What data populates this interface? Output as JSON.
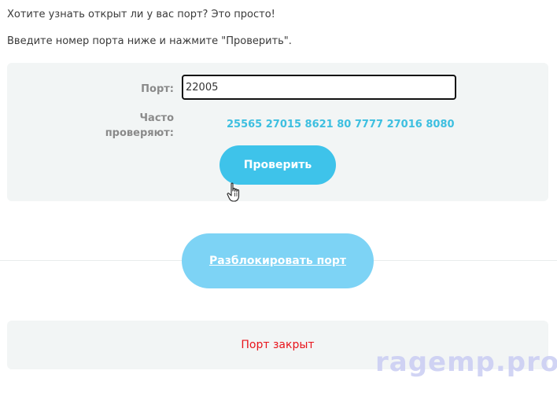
{
  "intro": {
    "line1": "Хотите узнать открыт ли у вас порт? Это просто!",
    "line2": "Введите номер порта ниже и нажмите \"Проверить\"."
  },
  "check_form": {
    "port_label": "Порт:",
    "port_value": "22005",
    "often_label": "Часто проверяют:",
    "often_ports": [
      "25565",
      "27015",
      "8621",
      "80",
      "7777",
      "27016",
      "8080"
    ],
    "check_button": "Проверить"
  },
  "unblock_button": "Разблокировать порт",
  "result": {
    "status": "Порт закрыт",
    "status_color": "#e8141b"
  },
  "watermark": "ragemp.pro",
  "colors": {
    "accent": "#3ec3ea",
    "accent_light": "#7dd3f5",
    "panel_bg": "#f2f5f5"
  }
}
